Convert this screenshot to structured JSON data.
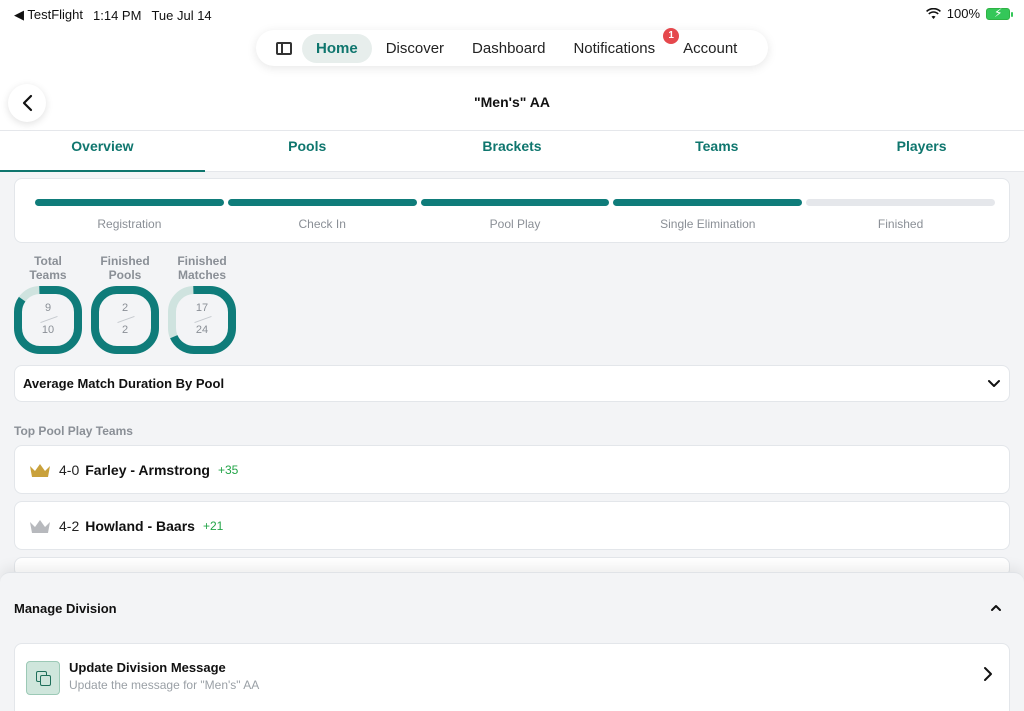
{
  "status_bar": {
    "back_app": "◀ TestFlight",
    "time": "1:14 PM",
    "date": "Tue Jul 14",
    "battery": "100%"
  },
  "nav": {
    "items": [
      {
        "label": "Home",
        "active": true
      },
      {
        "label": "Discover"
      },
      {
        "label": "Dashboard"
      },
      {
        "label": "Notifications",
        "badge": "1"
      },
      {
        "label": "Account"
      }
    ]
  },
  "page": {
    "title": "\"Men's\" AA"
  },
  "tabs": [
    "Overview",
    "Pools",
    "Brackets",
    "Teams",
    "Players"
  ],
  "progress": {
    "steps": [
      {
        "label": "Registration",
        "done": true
      },
      {
        "label": "Check In",
        "done": true
      },
      {
        "label": "Pool Play",
        "done": true
      },
      {
        "label": "Single Elimination",
        "done": true
      },
      {
        "label": "Finished",
        "done": false
      }
    ]
  },
  "stats": [
    {
      "caption_1": "Total",
      "caption_2": "Teams",
      "value": "9",
      "total": "10"
    },
    {
      "caption_1": "Finished",
      "caption_2": "Pools",
      "value": "2",
      "total": "2"
    },
    {
      "caption_1": "Finished",
      "caption_2": "Matches",
      "value": "17",
      "total": "24"
    }
  ],
  "duration": {
    "title": "Average Match Duration By Pool"
  },
  "top_teams": {
    "label": "Top Pool Play Teams",
    "rows": [
      {
        "record": "4-0",
        "name": "Farley - Armstrong",
        "delta": "+35",
        "crown_color": "#c9a13b"
      },
      {
        "record": "4-2",
        "name": "Howland - Baars",
        "delta": "+21",
        "crown_color": "#b7b9bd"
      }
    ]
  },
  "manage": {
    "title": "Manage Division",
    "action": {
      "title": "Update Division Message",
      "subtitle": "Update the message for \"Men's\" AA"
    }
  },
  "colors": {
    "accent": "#0f766e",
    "ring": "#0f7c7a",
    "ring_track": "#cfe3df",
    "positive": "#22a447"
  }
}
